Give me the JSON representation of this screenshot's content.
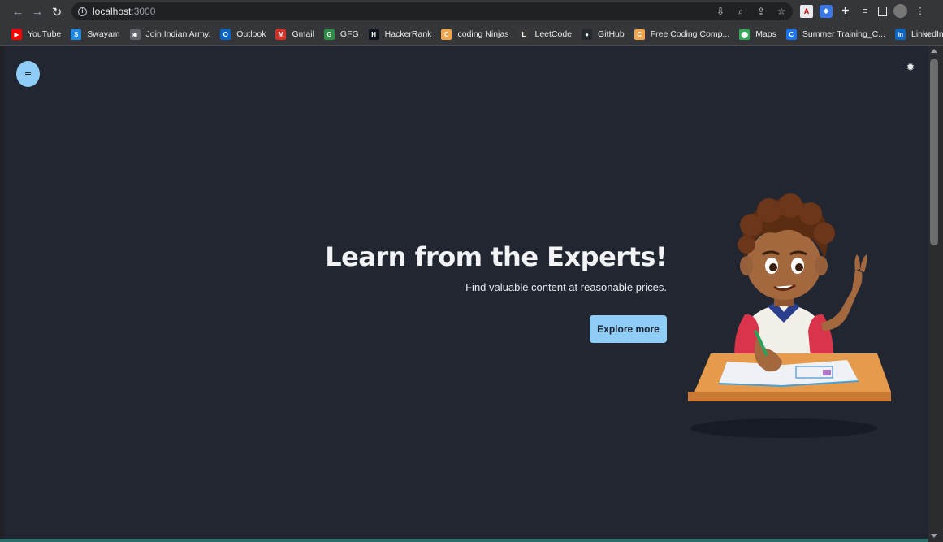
{
  "browser": {
    "url_host": "localhost",
    "url_port": ":3000",
    "toolbar_icons": [
      "back-arrow-icon",
      "forward-arrow-icon",
      "reload-icon",
      "info-icon",
      "install-icon",
      "zoom-icon",
      "share-icon",
      "star-icon"
    ],
    "bookmarks": [
      {
        "label": "YouTube",
        "icon": "youtube-icon",
        "color": "#ff0000",
        "glyph": "▶"
      },
      {
        "label": "Swayam",
        "icon": "swayam-icon",
        "color": "#1e88e5",
        "glyph": "S"
      },
      {
        "label": "Join Indian Army.",
        "icon": "globe-icon",
        "color": "#5f6368",
        "glyph": "◉"
      },
      {
        "label": "Outlook",
        "icon": "outlook-icon",
        "color": "#0a64c8",
        "glyph": "O"
      },
      {
        "label": "Gmail",
        "icon": "gmail-icon",
        "color": "#d93025",
        "glyph": "M"
      },
      {
        "label": "GFG",
        "icon": "gfg-icon",
        "color": "#2f8d46",
        "glyph": "G"
      },
      {
        "label": "HackerRank",
        "icon": "hackerrank-icon",
        "color": "#0e141e",
        "glyph": "H"
      },
      {
        "label": "coding Ninjas",
        "icon": "coding-ninjas-icon",
        "color": "#f0a44b",
        "glyph": "C"
      },
      {
        "label": "LeetCode",
        "icon": "leetcode-icon",
        "color": "#3a3a3a",
        "glyph": "L"
      },
      {
        "label": "GitHub",
        "icon": "github-icon",
        "color": "#24292e",
        "glyph": "●"
      },
      {
        "label": "Free Coding Comp...",
        "icon": "coding-comp-icon",
        "color": "#f0a44b",
        "glyph": "C"
      },
      {
        "label": "Maps",
        "icon": "maps-icon",
        "color": "#34a853",
        "glyph": "⬤"
      },
      {
        "label": "Summer Training_C...",
        "icon": "summer-training-icon",
        "color": "#1a73e8",
        "glyph": "C"
      },
      {
        "label": "LinkedIn",
        "icon": "linkedin-icon",
        "color": "#0a66c2",
        "glyph": "in"
      }
    ],
    "bookmarks_more": "»"
  },
  "page": {
    "background": "#212631",
    "accent": "#8fcdf6",
    "hero": {
      "title": "Learn from the Experts!",
      "subtitle": "Find valuable content at reasonable prices.",
      "cta_label": "Explore more"
    }
  }
}
